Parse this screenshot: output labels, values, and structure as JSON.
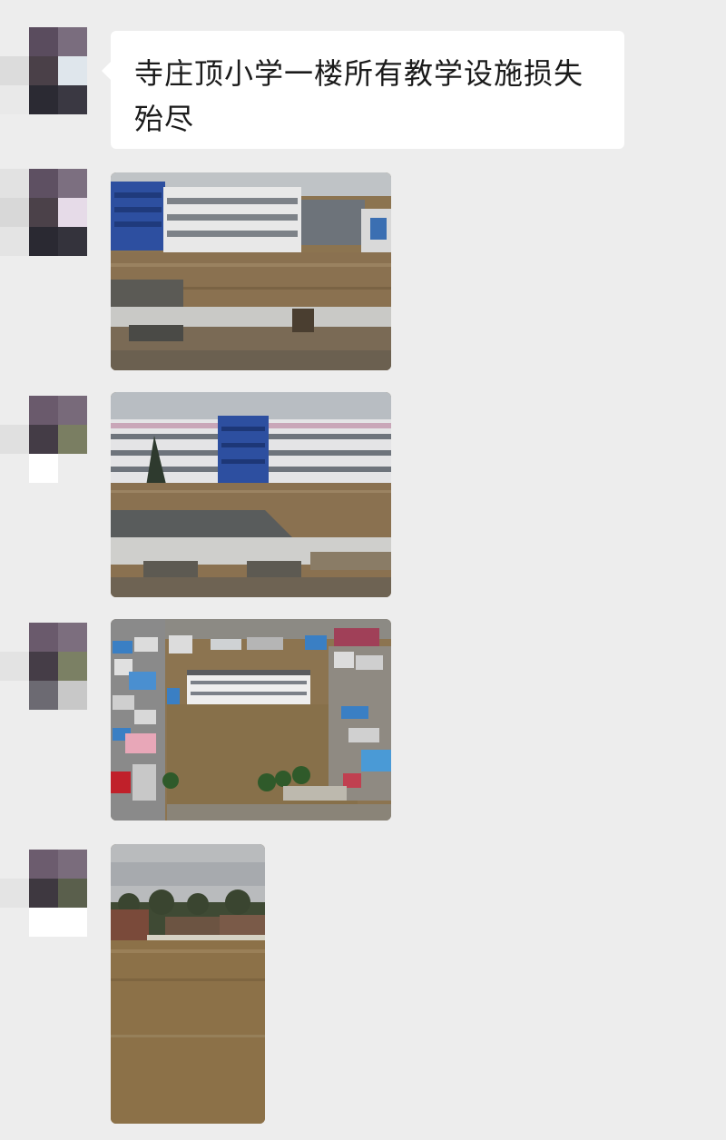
{
  "chat": {
    "messages": [
      {
        "type": "text",
        "text": "寺庄顶小学一楼所有教学设施损失殆尽"
      },
      {
        "type": "image",
        "icon": "flooded-school-building-photo"
      },
      {
        "type": "image",
        "icon": "flooded-school-courtyard-photo"
      },
      {
        "type": "image",
        "icon": "aerial-flooded-village-photo"
      },
      {
        "type": "image",
        "icon": "flooded-field-photo"
      }
    ]
  },
  "colors": {
    "background": "#ededed",
    "bubble": "#ffffff",
    "floodwater": "#8c7450",
    "building_blue": "#2d4fa0"
  }
}
